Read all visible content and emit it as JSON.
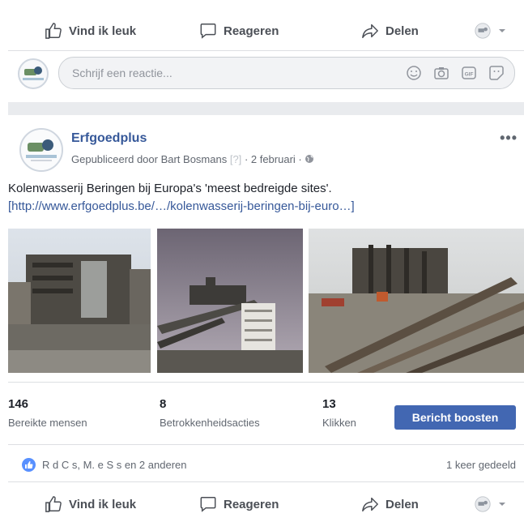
{
  "top_actions": {
    "like_label": "Vind ik leuk",
    "comment_label": "Reageren",
    "share_label": "Delen"
  },
  "comment": {
    "placeholder": "Schrijf een reactie..."
  },
  "post": {
    "page_name": "Erfgoedplus",
    "published_by": "Gepubliceerd door Bart Bosmans",
    "help_mark": "[?]",
    "date": "· 2 februari ·",
    "more_label": "•••",
    "text": "Kolenwasserij Beringen bij Europa's 'meest bedreigde sites'.",
    "link": "[http://www.erfgoedplus.be/…/kolenwasserij-beringen-bij-euro…]"
  },
  "stats": [
    {
      "value": "146",
      "label": "Bereikte mensen"
    },
    {
      "value": "8",
      "label": "Betrokkenheidsacties"
    },
    {
      "value": "13",
      "label": "Klikken"
    }
  ],
  "boost_label": "Bericht boosten",
  "reactions": {
    "names": "R      d C    s, M.      e S          s en 2 anderen",
    "shares": "1 keer gedeeld"
  },
  "bottom_actions": {
    "like_label": "Vind ik leuk",
    "comment_label": "Reageren",
    "share_label": "Delen"
  },
  "colors": {
    "link": "#365899",
    "boost": "#4267b2",
    "like_badge": "#5890ff",
    "divider": "#dddfe2"
  },
  "icons": [
    "thumbs-up-icon",
    "speech-bubble-icon",
    "share-arrow-icon",
    "globe-icon",
    "emoji-icon",
    "camera-icon",
    "gif-icon",
    "sticker-icon",
    "chevron-down-icon",
    "like-reaction-icon"
  ]
}
